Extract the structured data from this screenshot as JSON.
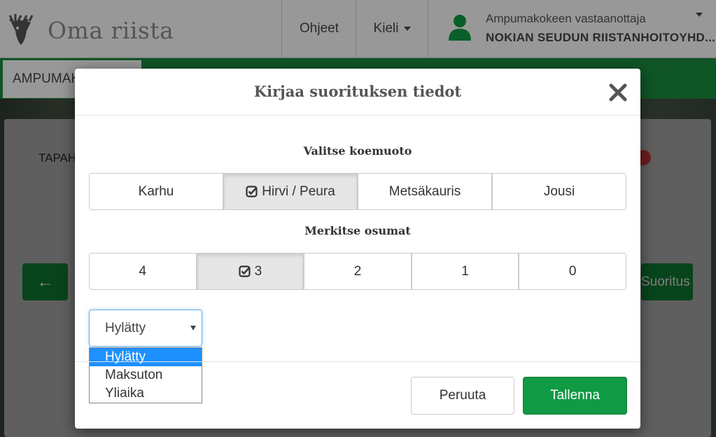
{
  "header": {
    "brand": "Oma riista",
    "nav": {
      "help": "Ohjeet",
      "language": "Kieli"
    },
    "user": {
      "role": "Ampumakokeen vastaanottaja",
      "organization": "NOKIAN SEUDUN RIISTANHOITOYHD..."
    }
  },
  "background": {
    "tab_label": "AMPUMAKOKEET",
    "card_label": "TAPAHTUMA",
    "right_button_label": "Suoritus"
  },
  "modal": {
    "title": "Kirjaa suorituksen tiedot",
    "test_type_label": "Valitse koemuoto",
    "test_types": [
      "Karhu",
      "Hirvi / Peura",
      "Metsäkauris",
      "Jousi"
    ],
    "selected_test_type": "Hirvi / Peura",
    "hits_label": "Merkitse osumat",
    "hits": [
      "4",
      "3",
      "2",
      "1",
      "0"
    ],
    "selected_hits": "3",
    "result_select": {
      "value": "Hylätty",
      "options": [
        "Hylätty",
        "Maksuton",
        "Yliaika"
      ],
      "highlighted": "Hylätty"
    },
    "cancel_label": "Peruuta",
    "save_label": "Tallenna"
  },
  "colors": {
    "brand_green": "#1b8a3c",
    "save_green": "#109a43",
    "highlight_blue": "#1e90ff"
  },
  "icons": {
    "logo": "moose-logo-icon",
    "user": "user-icon",
    "close": "close-icon",
    "check": "check-square-icon",
    "back": "arrow-left-icon"
  }
}
